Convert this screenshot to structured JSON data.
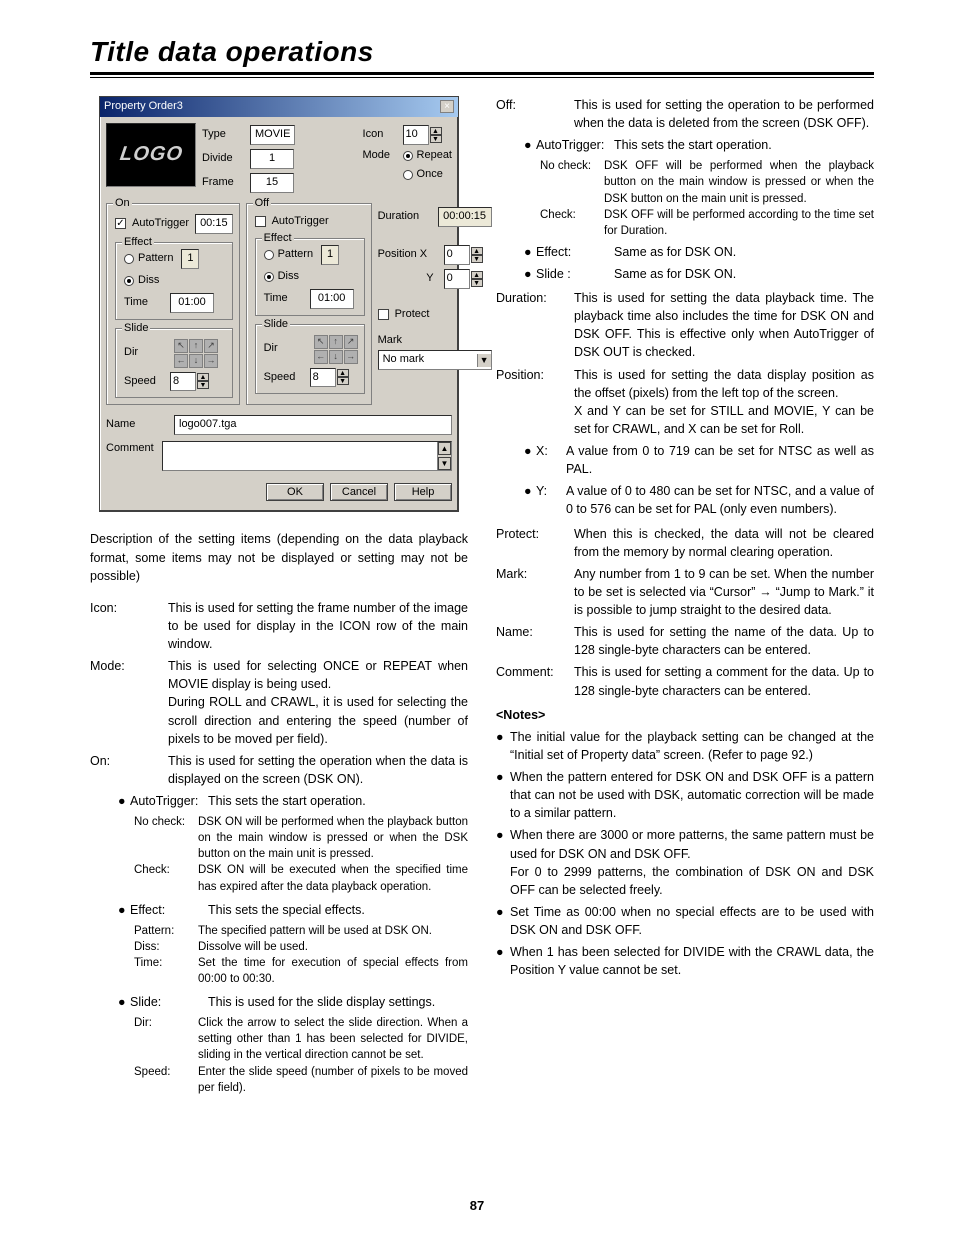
{
  "title": "Title data operations",
  "page_number": "87",
  "dialog": {
    "title": "Property  Order3",
    "logo_text": "LOGO",
    "type_label": "Type",
    "type_value": "MOVIE",
    "divide_label": "Divide",
    "divide_value": "1",
    "frame_label": "Frame",
    "frame_value": "15",
    "icon_label": "Icon",
    "icon_value": "10",
    "mode_label": "Mode",
    "mode_repeat": "Repeat",
    "mode_once": "Once",
    "on": {
      "legend": "On",
      "autotrigger": "AutoTrigger",
      "at_value": "00:15",
      "effect": "Effect",
      "pattern": "Pattern",
      "pat_val": "1",
      "diss": "Diss",
      "time": "Time",
      "time_val": "01:00",
      "slide": "Slide",
      "dir": "Dir",
      "speed": "Speed",
      "speed_val": "8"
    },
    "off": {
      "legend": "Off",
      "autotrigger": "AutoTrigger",
      "effect": "Effect",
      "pattern": "Pattern",
      "pat_val": "1",
      "diss": "Diss",
      "time": "Time",
      "time_val": "01:00",
      "slide": "Slide",
      "dir": "Dir",
      "speed": "Speed",
      "speed_val": "8"
    },
    "duration_label": "Duration",
    "duration_value": "00:00:15",
    "posx_label": "Position X",
    "posx": "0",
    "posy_label": "Y",
    "posy": "0",
    "protect": "Protect",
    "mark": "Mark",
    "mark_val": "No mark",
    "name_label": "Name",
    "name_value": "logo007.tga",
    "comment_label": "Comment",
    "ok": "OK",
    "cancel": "Cancel",
    "help": "Help"
  },
  "left": {
    "intro": "Description of the setting items (depending on the data playback format, some items may not be displayed or setting may not be possible)",
    "icon_t": "Icon:",
    "icon_d": "This is used for setting the frame number of the image to be used for display in the ICON row of the main window.",
    "mode_t": "Mode:",
    "mode_d1": "This is used for selecting ONCE or REPEAT when MOVIE display is being used.",
    "mode_d2": "During ROLL and CRAWL, it is used for selecting the scroll direction and entering the speed (number of pixels to be moved per field).",
    "on_t": "On:",
    "on_d": "This is used for setting the operation when the data is displayed on the screen (DSK ON).",
    "at_t": "AutoTrigger:",
    "at_d": "This sets the start operation.",
    "nc_t": "No check:",
    "nc_d": "DSK ON will be performed when the playback button on the main window is pressed or when the DSK button on the main unit is pressed.",
    "ck_t": "Check:",
    "ck_d": "DSK ON will be executed when the specified time has expired after the data playback operation.",
    "ef_t": "Effect:",
    "ef_d": "This sets the special effects.",
    "pat_t": "Pattern:",
    "pat_d": "The specified pattern will be used at DSK ON.",
    "diss_t": "Diss:",
    "diss_d": "Dissolve will be used.",
    "time_t": "Time:",
    "time_d": "Set the time for execution of special effects from 00:00 to 00:30.",
    "sl_t": "Slide:",
    "sl_d": "This is used for the slide display settings.",
    "dir_t": "Dir:",
    "dir_d": "Click the arrow to select the slide direction. When a setting other than 1 has been selected for DIVIDE, sliding in the vertical direction cannot be set.",
    "spd_t": "Speed:",
    "spd_d": "Enter the slide speed (number of pixels to be moved per field)."
  },
  "right": {
    "off_t": "Off:",
    "off_d": "This is used for setting the operation to be performed when the data is deleted from the screen (DSK OFF).",
    "at_t": "AutoTrigger:",
    "at_d": "This sets the start operation.",
    "nc_t": "No check:",
    "nc_d": "DSK OFF will be performed when the playback button on the main window is pressed or when the DSK button on the main unit is pressed.",
    "ck_t": "Check:",
    "ck_d": "DSK OFF will be performed according to the time set for Duration.",
    "ef_t": "Effect:",
    "ef_d": "Same as for DSK ON.",
    "sl_t": "Slide :",
    "sl_d": "Same as for DSK ON.",
    "dur_t": "Duration:",
    "dur_d": "This is used for setting the data playback time.  The playback time also includes the time for DSK ON and DSK OFF.  This is effective only when AutoTrigger of DSK OUT is checked.",
    "pos_t": "Position:",
    "pos_d1": "This is used for setting the data display position as the offset (pixels) from the left top of the screen.",
    "pos_d2": "X and Y can be set for STILL and MOVIE, Y can be set for CRAWL, and X can be set for Roll.",
    "x_t": "X:",
    "x_d": "A value from 0 to 719 can be set for NTSC as well as PAL.",
    "y_t": "Y:",
    "y_d": "A value of 0 to 480 can be set for NTSC, and a value of 0 to 576 can be set for PAL (only even numbers).",
    "pro_t": "Protect:",
    "pro_d": "When this is checked, the data will not be cleared from the memory by normal clearing operation.",
    "mark_t": "Mark:",
    "mark_d": "Any number from 1 to 9 can be set.  When the number to be set is selected via “Cursor” → “Jump to Mark.”  it is possible to jump straight to the desired data.",
    "name_t": "Name:",
    "name_d": "This is used for setting the name of the data.  Up to 128 single-byte characters can be entered.",
    "cmt_t": "Comment:",
    "cmt_d": "This is used for setting a comment for the data. Up to 128 single-byte characters can be entered.",
    "notes_h": "<Notes>",
    "n1": "The initial value for the playback setting can be changed at the “Initial set of Property data” screen.  (Refer to page 92.)",
    "n2": "When the pattern entered for DSK ON and DSK OFF is a pattern that can not be used with DSK, automatic correction will be made to a similar pattern.",
    "n3a": "When there are 3000 or more patterns, the same pattern must be used for DSK ON and DSK OFF.",
    "n3b": "For 0 to 2999 patterns, the combination of DSK ON and DSK OFF can be selected freely.",
    "n4": "Set Time as 00:00 when no special effects are to be used with DSK ON and DSK OFF.",
    "n5": "When 1 has been selected for DIVIDE with the CRAWL data, the Position Y value cannot be set."
  }
}
